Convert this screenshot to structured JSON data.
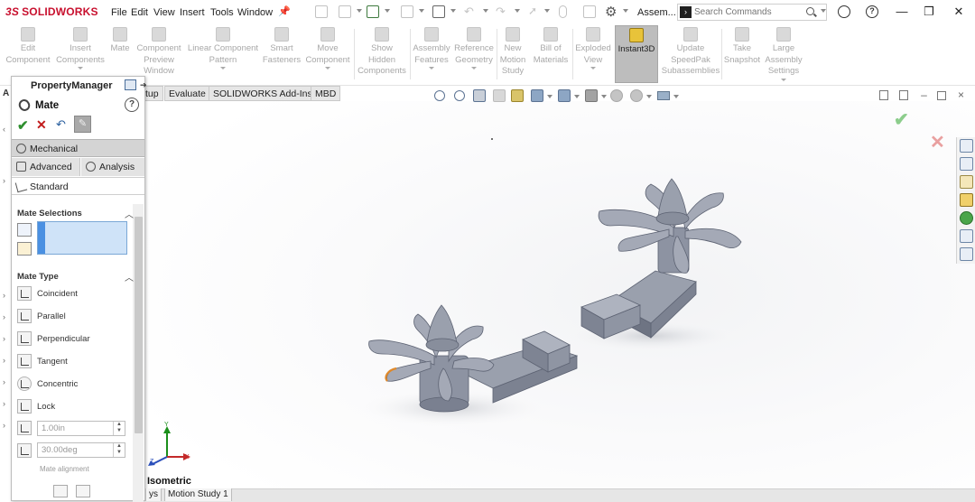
{
  "titlebar": {
    "logo_ds": "3S",
    "logo_name": "SOLIDWORKS",
    "menus": [
      "File",
      "Edit",
      "View",
      "Insert",
      "Tools",
      "Window"
    ],
    "document_name": "Assem...",
    "search_placeholder": "Search Commands",
    "window_buttons": {
      "minimize": "—",
      "restore": "❐",
      "close": "✕"
    },
    "help_glyph": "?"
  },
  "command_manager": {
    "items": [
      {
        "label": "Edit\nComponent"
      },
      {
        "label": "Insert\nComponents"
      },
      {
        "label": "Mate"
      },
      {
        "label": "Component\nPreview\nWindow"
      },
      {
        "label": "Linear Component\nPattern"
      },
      {
        "label": "Smart\nFasteners"
      },
      {
        "label": "Move\nComponent"
      },
      {
        "label": "Show\nHidden\nComponents"
      },
      {
        "label": "Assembly\nFeatures"
      },
      {
        "label": "Reference\nGeometry"
      },
      {
        "label": "New\nMotion\nStudy"
      },
      {
        "label": "Bill of\nMaterials"
      },
      {
        "label": "Exploded\nView"
      },
      {
        "label": "Instant3D"
      },
      {
        "label": "Update\nSpeedPak\nSubassemblies"
      },
      {
        "label": "Take\nSnapshot"
      },
      {
        "label": "Large\nAssembly\nSettings"
      }
    ]
  },
  "tabs": [
    "tup",
    "Evaluate",
    "SOLIDWORKS Add-Ins",
    "MBD"
  ],
  "property_manager": {
    "header": "PropertyManager",
    "feature_title": "Mate",
    "help": "?",
    "ok_glyph": "✔",
    "cancel_glyph": "✕",
    "undo_glyph": "↶",
    "pin_glyph": "📌",
    "tabs": {
      "mechanical": "Mechanical",
      "advanced": "Advanced",
      "analysis": "Analysis",
      "standard": "Standard"
    },
    "mate_selections_title": "Mate Selections",
    "mate_type_title": "Mate Type",
    "mate_types": [
      "Coincident",
      "Parallel",
      "Perpendicular",
      "Tangent",
      "Concentric",
      "Lock"
    ],
    "distance_value": "1.00in",
    "angle_value": "30.00deg",
    "mate_alignment_label": "Mate alignment"
  },
  "graphics": {
    "view_orientation": "Isometric",
    "triad_labels": {
      "x": "X",
      "y": "Y",
      "z": "Z"
    }
  },
  "bottom_tabs": [
    "ys",
    "Motion Study 1"
  ],
  "colors": {
    "brand_red": "#c8102e",
    "part_fill": "#9096a4",
    "part_dark": "#6a7080",
    "part_light": "#b6bbc7",
    "selection_blue": "#cfe3f8",
    "ok_green": "#2f8f2f",
    "cancel_red": "#c21b1b",
    "highlight_orange": "#e0892a"
  }
}
